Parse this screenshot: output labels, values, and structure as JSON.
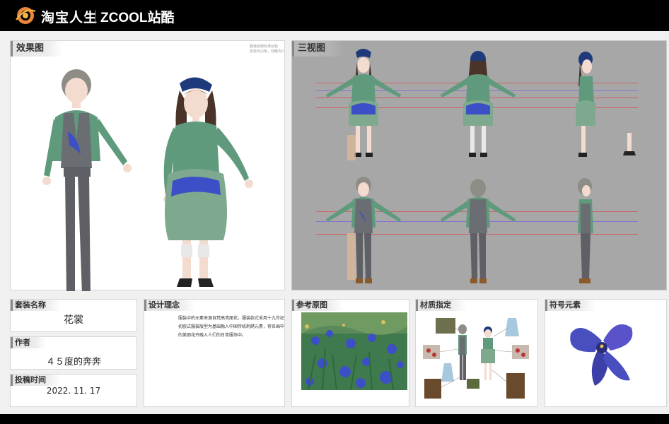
{
  "header": {
    "brand_taobao": "淘宝人生",
    "brand_zcool": "ZCOOL站酷"
  },
  "effect": {
    "title": "效果图",
    "note_line1": "服装绘制标准台色",
    "note_line2": "底色为白色，线稿为0"
  },
  "three_view": {
    "title": "三视图"
  },
  "outfit": {
    "name_label": "套装名称",
    "name_value": "花裳",
    "author_label": "作者",
    "author_value": "４５度的奔奔",
    "date_label": "投稿时间",
    "date_value": "2022. 11. 17"
  },
  "concept": {
    "title": "设计理念",
    "text": "服装中的元素来源自梵高鸢尾花，服装款式采用十九世纪初欧式服装版型为基础融入中国传统刺绣元素，将名画中的美丽花卉融入人们的日常服饰中。"
  },
  "reference": {
    "title": "参考原图"
  },
  "material": {
    "title": "材质指定"
  },
  "symbol": {
    "title": "符号元素"
  },
  "colors": {
    "topbar": "#000000",
    "three_view_bg": "#a7a7a7",
    "shirt_green": "#5f9a7c",
    "vest_gray": "#6a6d72",
    "iris_blue": "#3d4fc7",
    "hat_navy": "#1f3a7a"
  }
}
